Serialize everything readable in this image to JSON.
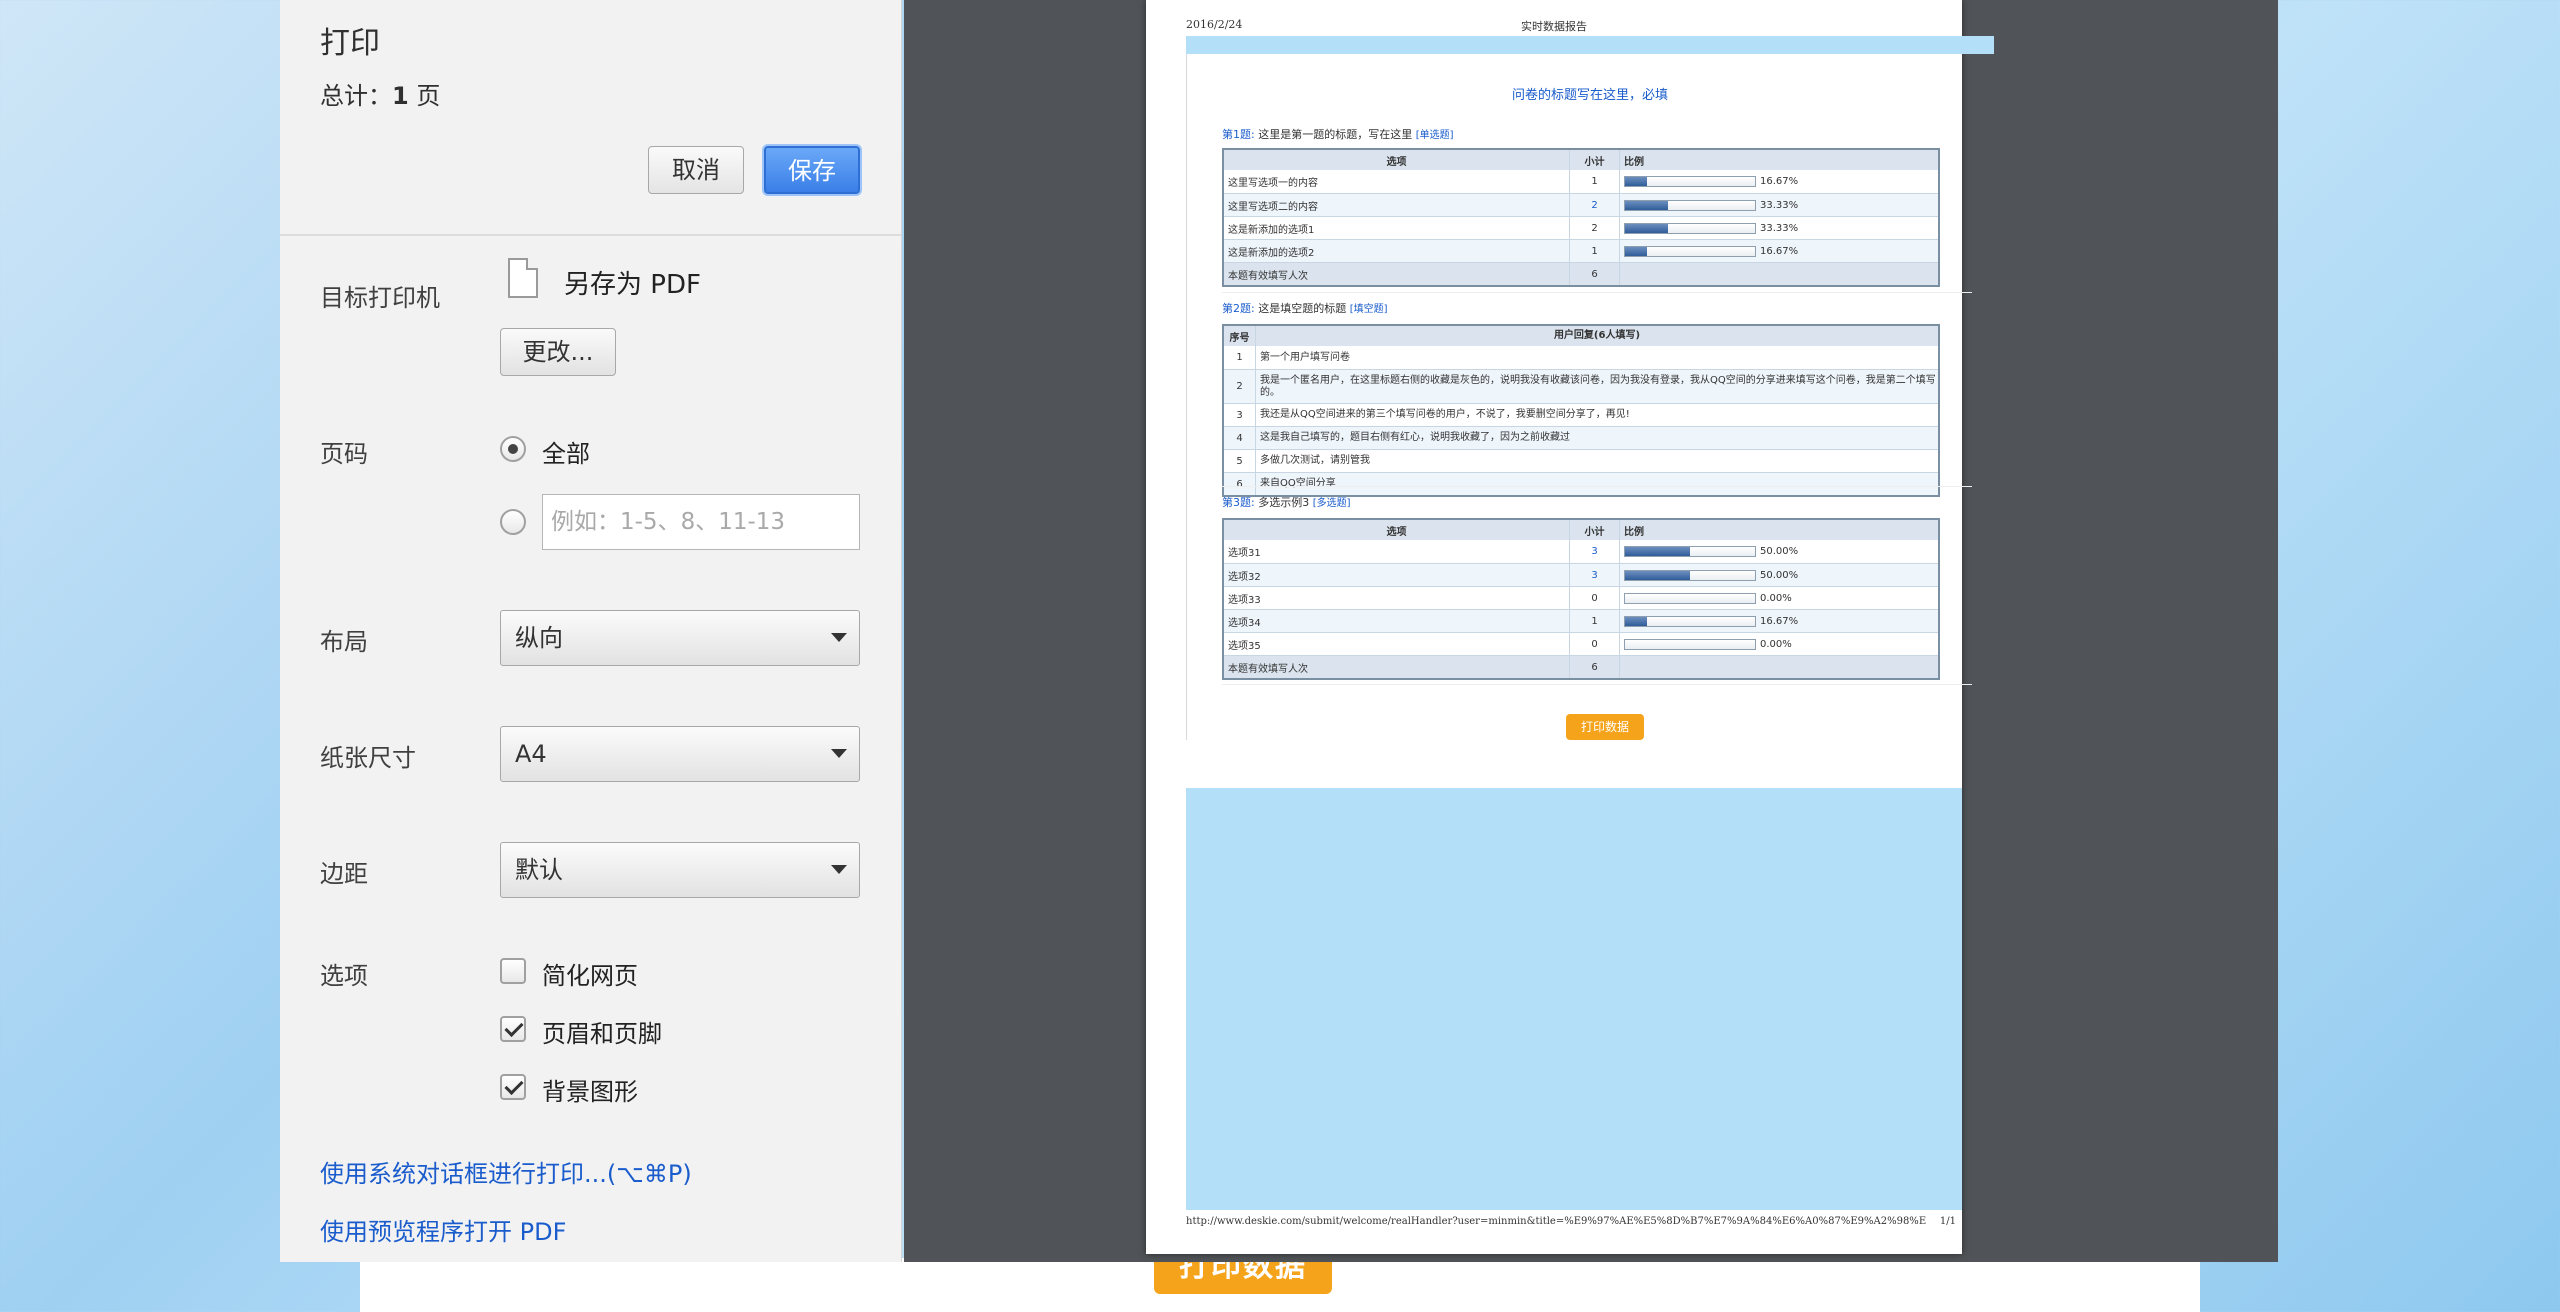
{
  "background": {
    "print_button": "打印数据"
  },
  "panel": {
    "title": "打印",
    "total_label": "总计：",
    "total_count": "1",
    "total_unit": " 页",
    "cancel": "取消",
    "save": "保存",
    "destination_label": "目标打印机",
    "destination_value": "另存为 PDF",
    "change": "更改...",
    "pages_label": "页码",
    "pages_all": "全部",
    "pages_placeholder": "例如：1-5、8、11-13",
    "layout_label": "布局",
    "layout_value": "纵向",
    "paper_label": "纸张尺寸",
    "paper_value": "A4",
    "margins_label": "边距",
    "margins_value": "默认",
    "options_label": "选项",
    "opt_simplify": "简化网页",
    "opt_headers": "页眉和页脚",
    "opt_background": "背景图形",
    "link_system": "使用系统对话框进行打印...(⌥⌘P)",
    "link_preview": "使用预览程序打开 PDF"
  },
  "sheet": {
    "date": "2016/2/24",
    "header_title": "实时数据报告",
    "survey_title": "问卷的标题写在这里，必填",
    "q1": {
      "num": "第1题:",
      "text": "这里是第一题的标题，写在这里",
      "type": "[单选题]",
      "cols": [
        "选项",
        "小计",
        "比例"
      ],
      "rows": [
        {
          "option": "这里写选项一的内容",
          "count": "1",
          "pct": "16.67%",
          "ratio": 0.1667
        },
        {
          "option": "这里写选项二的内容",
          "count": "2",
          "pct": "33.33%",
          "ratio": 0.3333
        },
        {
          "option": "这是新添加的选项1",
          "count": "2",
          "pct": "33.33%",
          "ratio": 0.3333
        },
        {
          "option": "这是新添加的选项2",
          "count": "1",
          "pct": "16.67%",
          "ratio": 0.1667
        }
      ],
      "footer": {
        "label": "本题有效填写人次",
        "count": "6"
      }
    },
    "q2": {
      "num": "第2题:",
      "text": "这是填空题的标题",
      "type": "[填空题]",
      "cols": [
        "序号",
        "用户回复(6人填写)"
      ],
      "rows": [
        {
          "n": "1",
          "text": "第一个用户填写问卷"
        },
        {
          "n": "2",
          "text": "我是一个匿名用户，在这里标题右侧的收藏是灰色的，说明我没有收藏该问卷，因为我没有登录，我从QQ空间的分享进来填写这个问卷，我是第二个填写的。"
        },
        {
          "n": "3",
          "text": "我还是从QQ空间进来的第三个填写问卷的用户，不说了，我要删空间分享了，再见!"
        },
        {
          "n": "4",
          "text": "这是我自己填写的，题目右侧有红心，说明我收藏了，因为之前收藏过"
        },
        {
          "n": "5",
          "text": "多做几次测试，请别管我"
        },
        {
          "n": "6",
          "text": "来自QQ空间分享"
        }
      ]
    },
    "q3": {
      "num": "第3题:",
      "text": "多选示例3",
      "type": "[多选题]",
      "cols": [
        "选项",
        "小计",
        "比例"
      ],
      "rows": [
        {
          "option": "选项31",
          "count": "3",
          "pct": "50.00%",
          "ratio": 0.5
        },
        {
          "option": "选项32",
          "count": "3",
          "pct": "50.00%",
          "ratio": 0.5
        },
        {
          "option": "选项33",
          "count": "0",
          "pct": "0.00%",
          "ratio": 0
        },
        {
          "option": "选项34",
          "count": "1",
          "pct": "16.67%",
          "ratio": 0.1667
        },
        {
          "option": "选项35",
          "count": "0",
          "pct": "0.00%",
          "ratio": 0
        }
      ],
      "footer": {
        "label": "本题有效填写人次",
        "count": "6"
      }
    },
    "print_button": "打印数据",
    "footer_url": "http://www.deskie.com/submit/welcome/realHandler?user=minmin&title=%E9%97%AE%E5%8D%B7%E7%9A%84%E6%A0%87%E9%A2%98%E5%86...",
    "footer_page": "1/1"
  }
}
